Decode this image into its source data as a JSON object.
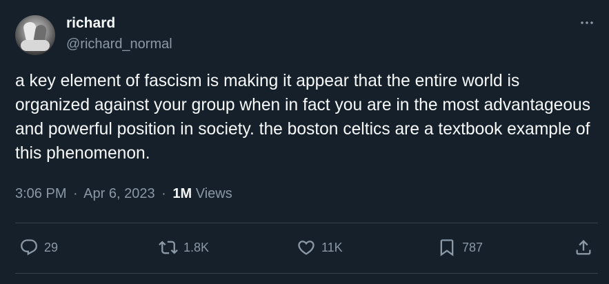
{
  "author": {
    "name": "richard",
    "handle": "@richard_normal"
  },
  "tweet": {
    "text": "a key element of fascism is making it appear that the entire world is organized against your group when in fact you are in the most advantageous and powerful position in society. the boston celtics are a textbook example of this phenomenon.",
    "time": "3:06 PM",
    "separator": "·",
    "date": "Apr 6, 2023",
    "views_count": "1M",
    "views_label": "Views"
  },
  "actions": {
    "replies": "29",
    "retweets": "1.8K",
    "likes": "11K",
    "bookmarks": "787"
  },
  "icons": {
    "more": "more-horizontal-icon",
    "reply": "reply-icon",
    "retweet": "retweet-icon",
    "like": "heart-icon",
    "bookmark": "bookmark-icon",
    "share": "share-icon"
  },
  "colors": {
    "background": "#15202b",
    "text": "#f7f9f9",
    "secondary_text": "#8b98a5",
    "divider": "#38444d"
  }
}
